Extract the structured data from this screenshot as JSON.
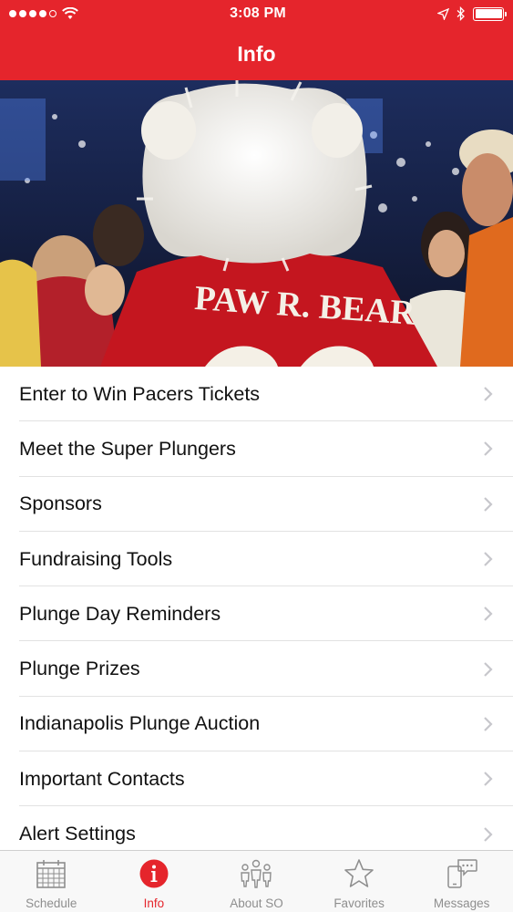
{
  "status_bar": {
    "time": "3:08 PM",
    "signal_dots_filled": 4,
    "signal_dots_total": 5,
    "icons": [
      "wifi-icon",
      "location-icon",
      "bluetooth-icon",
      "battery-icon"
    ]
  },
  "nav": {
    "title": "Info"
  },
  "hero": {
    "jersey_text": "PAW R. BEAR"
  },
  "menu": {
    "items": [
      {
        "label": "Enter to Win Pacers Tickets"
      },
      {
        "label": "Meet the Super Plungers"
      },
      {
        "label": "Sponsors"
      },
      {
        "label": "Fundraising Tools"
      },
      {
        "label": "Plunge Day Reminders"
      },
      {
        "label": "Plunge Prizes"
      },
      {
        "label": "Indianapolis Plunge Auction"
      },
      {
        "label": "Important Contacts"
      },
      {
        "label": "Alert Settings"
      }
    ]
  },
  "tabs": {
    "active": "Info",
    "items": [
      {
        "label": "Schedule",
        "icon": "calendar-icon"
      },
      {
        "label": "Info",
        "icon": "info-icon"
      },
      {
        "label": "About SO",
        "icon": "people-icon"
      },
      {
        "label": "Favorites",
        "icon": "star-icon"
      },
      {
        "label": "Messages",
        "icon": "messages-icon"
      }
    ]
  },
  "colors": {
    "brand_red": "#e5252c",
    "tab_inactive": "#8e8e8e",
    "chevron": "#c7c7cc"
  }
}
